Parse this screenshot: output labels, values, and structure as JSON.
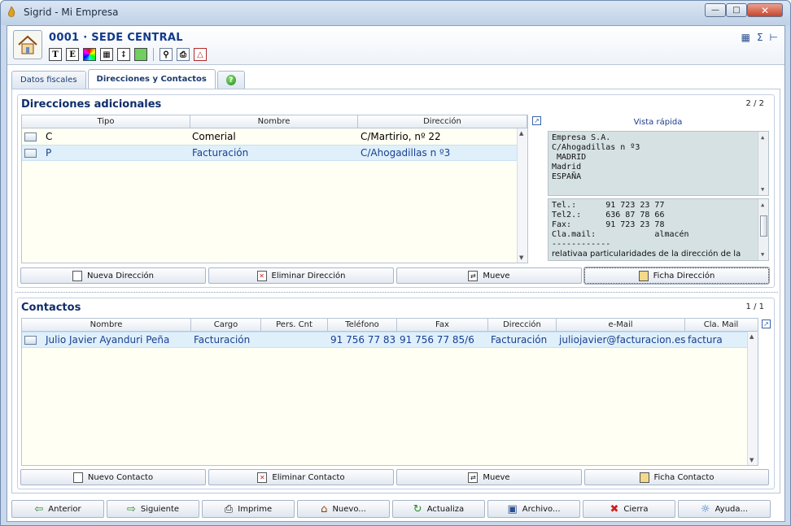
{
  "window": {
    "title": "Sigrid - Mi Empresa"
  },
  "header": {
    "title": "0001 · SEDE CENTRAL",
    "tool_letters": [
      "T",
      "E"
    ]
  },
  "tabs": [
    {
      "label": "Datos fiscales"
    },
    {
      "label": "Direcciones y Contactos"
    },
    {
      "label": "?"
    }
  ],
  "direcciones": {
    "title": "Direcciones adicionales",
    "count": "2 / 2",
    "columns": [
      "Tipo",
      "Nombre",
      "Dirección"
    ],
    "rows": [
      {
        "tipo": "C",
        "nombre": "Comerial",
        "direccion": "C/Martirio, nº 22"
      },
      {
        "tipo": "P",
        "nombre": "Facturación",
        "direccion": "C/Ahogadillas n º3"
      }
    ],
    "quick_view_title": "Vista rápida",
    "quick_address": [
      "Empresa S.A.",
      "C/Ahogadillas n º3",
      " MADRID",
      "Madrid",
      "ESPAÑA"
    ],
    "quick_contact": [
      "Tel.:      91 723 23 77",
      "Tel2.:     636 87 78 66",
      "Fax:       91 723 23 78",
      "Cla.mail:            almacén",
      "------------",
      "relativaa particularidades de la dirección de la"
    ],
    "buttons": [
      "Nueva Dirección",
      "Eliminar Dirección",
      "Mueve",
      "Ficha Dirección"
    ]
  },
  "contactos": {
    "title": "Contactos",
    "count": "1 / 1",
    "columns": [
      "Nombre",
      "Cargo",
      "Pers. Cnt",
      "Teléfono",
      "Fax",
      "Dirección",
      "e-Mail",
      "Cla. Mail"
    ],
    "rows": [
      {
        "nombre": "Julio Javier Ayanduri Peña",
        "cargo": "Facturación",
        "pers": "",
        "telefono": "91 756 77 83",
        "fax": "91 756 77 85/6",
        "direccion": "Facturación",
        "email": "juliojavier@facturacion.es",
        "clamail": "factura"
      }
    ],
    "buttons": [
      "Nuevo Contacto",
      "Eliminar Contacto",
      "Mueve",
      "Ficha Contacto"
    ]
  },
  "bottom": [
    "Anterior",
    "Siguiente",
    "Imprime",
    "Nuevo...",
    "Actualiza",
    "Archivo...",
    "Cierra",
    "Ayuda..."
  ]
}
